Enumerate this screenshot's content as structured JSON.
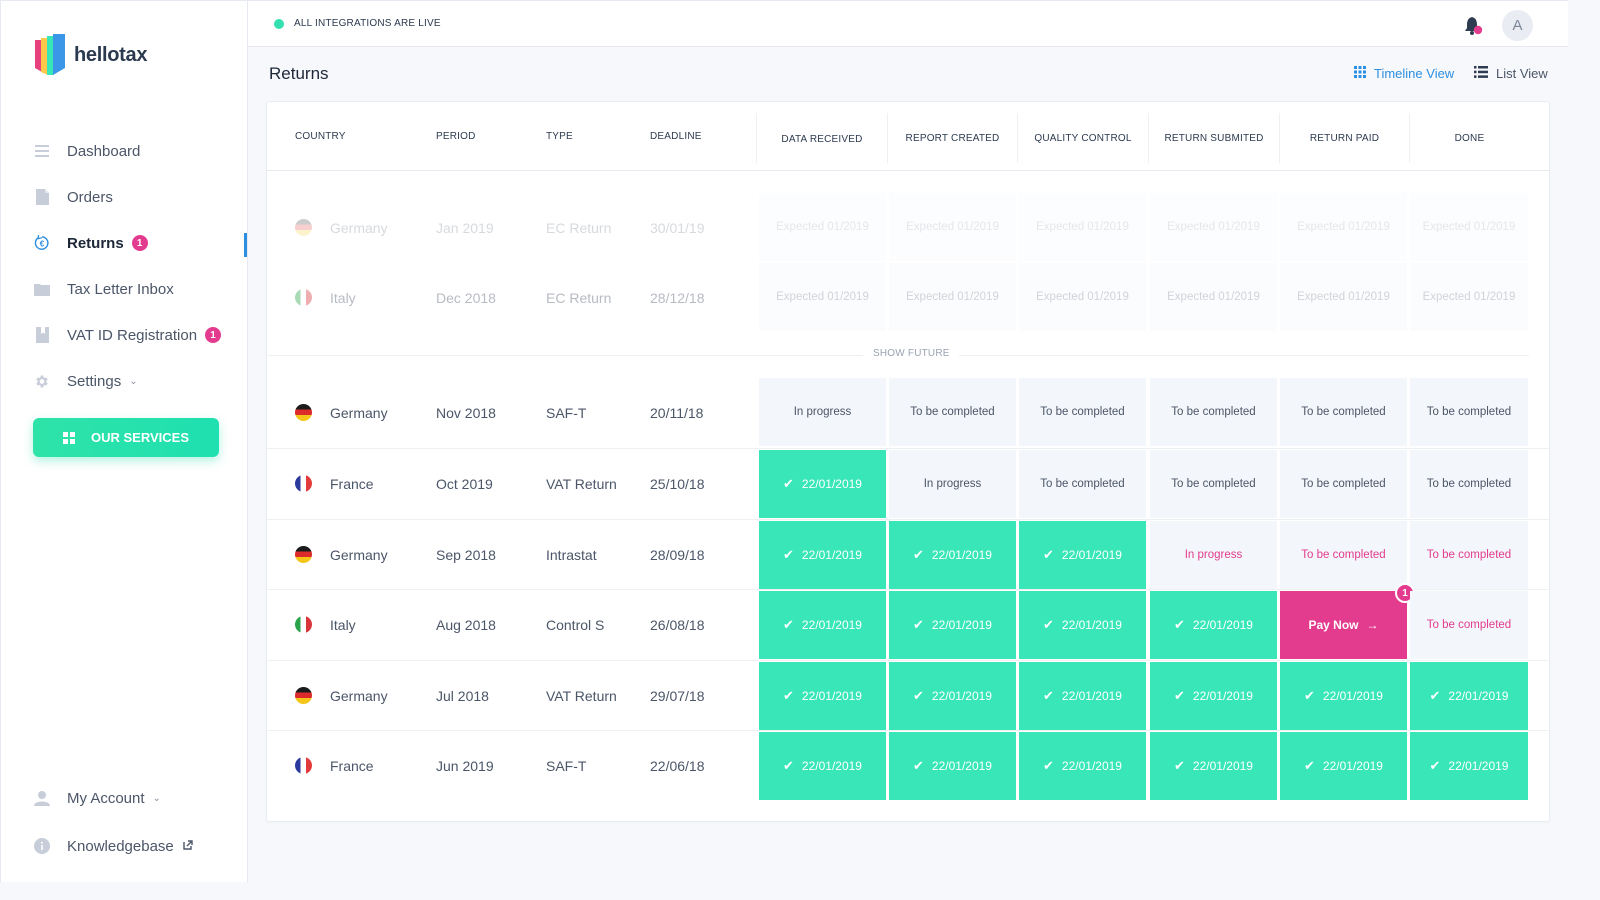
{
  "app": {
    "brand": "hellotax",
    "brand_colors": {
      "pink": "#e8407f",
      "yellow": "#fcc84a",
      "green": "#38e6b8",
      "blue": "#3a97e8"
    }
  },
  "sidebar": {
    "items": [
      {
        "label": "Dashboard",
        "icon": "menu-lines-icon",
        "active": false,
        "badge": null
      },
      {
        "label": "Orders",
        "icon": "document-icon",
        "active": false,
        "badge": null
      },
      {
        "label": "Returns",
        "icon": "euro-refresh-icon",
        "active": true,
        "badge": "1"
      },
      {
        "label": "Tax Letter Inbox",
        "icon": "folder-icon",
        "active": false,
        "badge": null
      },
      {
        "label": "VAT ID Registration",
        "icon": "bookmark-book-icon",
        "active": false,
        "badge": "1"
      },
      {
        "label": "Settings",
        "icon": "gear-icon",
        "active": false,
        "badge": null,
        "dropdown": true
      }
    ],
    "services_button": "OUR SERVICES",
    "bottom_items": [
      {
        "label": "My Account",
        "icon": "user-icon",
        "dropdown": true
      },
      {
        "label": "Knowledgebase",
        "icon": "info-icon",
        "external": true
      }
    ]
  },
  "topbar": {
    "status_text": "ALL INTEGRATIONS ARE LIVE",
    "status_color": "#33e0b0",
    "avatar_initial": "A",
    "notification_dot": true
  },
  "page": {
    "title": "Returns",
    "views": [
      {
        "label": "Timeline View",
        "icon": "grid-icon",
        "active": true
      },
      {
        "label": "List View",
        "icon": "list-icon",
        "active": false
      }
    ]
  },
  "table": {
    "columns": [
      "COUNTRY",
      "PERIOD",
      "TYPE",
      "DEADLINE"
    ],
    "stages": [
      "DATA RECEIVED",
      "REPORT CREATED",
      "QUALITY CONTROL",
      "RETURN SUBMITED",
      "RETURN PAID",
      "DONE"
    ],
    "show_future_label": "SHOW FUTURE",
    "future_rows": [
      {
        "country": "Germany",
        "flag": "de",
        "period": "Jan 2019",
        "type": "EC Return",
        "deadline": "30/01/19",
        "stages": [
          "Expected 01/2019",
          "Expected 01/2019",
          "Expected 01/2019",
          "Expected 01/2019",
          "Expected 01/2019",
          "Expected 01/2019"
        ]
      },
      {
        "country": "Italy",
        "flag": "it",
        "period": "Dec 2018",
        "type": "EC Return",
        "deadline": "28/12/18",
        "stages": [
          "Expected 01/2019",
          "Expected 01/2019",
          "Expected 01/2019",
          "Expected 01/2019",
          "Expected 01/2019",
          "Expected 01/2019"
        ]
      }
    ],
    "rows": [
      {
        "country": "Germany",
        "flag": "de",
        "period": "Nov 2018",
        "type": "SAF-T",
        "deadline": "20/11/18",
        "stages": [
          {
            "status": "pending",
            "text": "In progress"
          },
          {
            "status": "pending",
            "text": "To be completed"
          },
          {
            "status": "pending",
            "text": "To be completed"
          },
          {
            "status": "pending",
            "text": "To be completed"
          },
          {
            "status": "pending",
            "text": "To be completed"
          },
          {
            "status": "pending",
            "text": "To be completed"
          }
        ]
      },
      {
        "country": "France",
        "flag": "fr",
        "period": "Oct 2019",
        "type": "VAT Return",
        "deadline": "25/10/18",
        "stages": [
          {
            "status": "done",
            "text": "22/01/2019"
          },
          {
            "status": "pending",
            "text": "In progress"
          },
          {
            "status": "pending",
            "text": "To be completed"
          },
          {
            "status": "pending",
            "text": "To be completed"
          },
          {
            "status": "pending",
            "text": "To be completed"
          },
          {
            "status": "pending",
            "text": "To be completed"
          }
        ]
      },
      {
        "country": "Germany",
        "flag": "de",
        "period": "Sep 2018",
        "type": "Intrastat",
        "deadline": "28/09/18",
        "stages": [
          {
            "status": "done",
            "text": "22/01/2019"
          },
          {
            "status": "done",
            "text": "22/01/2019"
          },
          {
            "status": "done",
            "text": "22/01/2019"
          },
          {
            "status": "alert",
            "text": "In progress"
          },
          {
            "status": "alert",
            "text": "To be completed"
          },
          {
            "status": "alert",
            "text": "To be completed"
          }
        ]
      },
      {
        "country": "Italy",
        "flag": "it",
        "period": "Aug 2018",
        "type": "Control S",
        "deadline": "26/08/18",
        "stages": [
          {
            "status": "done",
            "text": "22/01/2019"
          },
          {
            "status": "done",
            "text": "22/01/2019"
          },
          {
            "status": "done",
            "text": "22/01/2019"
          },
          {
            "status": "done",
            "text": "22/01/2019"
          },
          {
            "status": "pay",
            "text": "Pay Now",
            "badge": "1"
          },
          {
            "status": "alert",
            "text": "To be completed"
          }
        ]
      },
      {
        "country": "Germany",
        "flag": "de",
        "period": "Jul 2018",
        "type": "VAT Return",
        "deadline": "29/07/18",
        "stages": [
          {
            "status": "done",
            "text": "22/01/2019"
          },
          {
            "status": "done",
            "text": "22/01/2019"
          },
          {
            "status": "done",
            "text": "22/01/2019"
          },
          {
            "status": "done",
            "text": "22/01/2019"
          },
          {
            "status": "done",
            "text": "22/01/2019"
          },
          {
            "status": "done",
            "text": "22/01/2019"
          }
        ]
      },
      {
        "country": "France",
        "flag": "fr",
        "period": "Jun 2019",
        "type": "SAF-T",
        "deadline": "22/06/18",
        "stages": [
          {
            "status": "done",
            "text": "22/01/2019"
          },
          {
            "status": "done",
            "text": "22/01/2019"
          },
          {
            "status": "done",
            "text": "22/01/2019"
          },
          {
            "status": "done",
            "text": "22/01/2019"
          },
          {
            "status": "done",
            "text": "22/01/2019"
          },
          {
            "status": "done",
            "text": "22/01/2019"
          }
        ]
      }
    ]
  },
  "colors": {
    "done": "#38e6b8",
    "alert": "#e33c8f",
    "pending_bg": "#f3f6fa",
    "accent": "#2c8fe0"
  }
}
